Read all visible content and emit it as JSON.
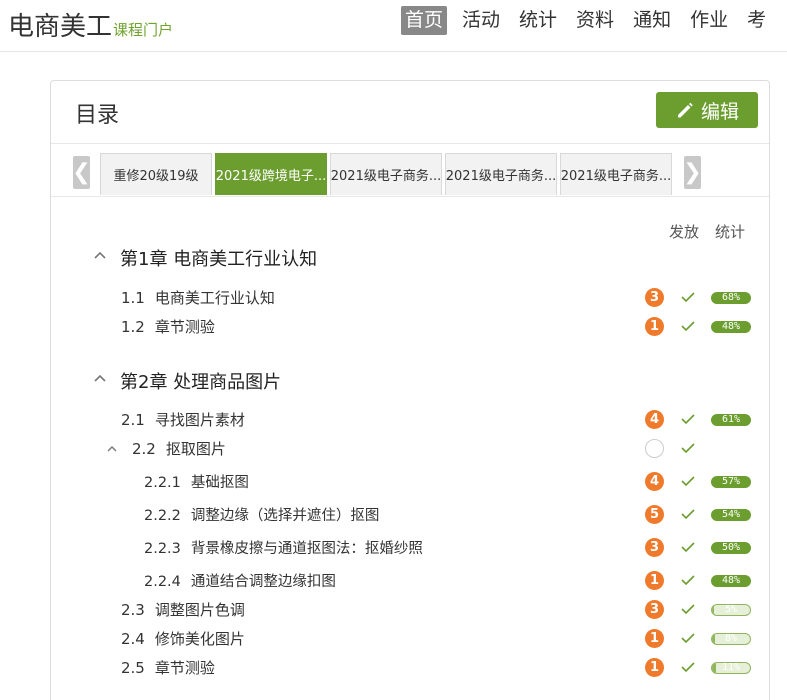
{
  "header": {
    "brand_title": "电商美工",
    "brand_sub": "课程门户",
    "nav": [
      "首页",
      "活动",
      "统计",
      "资料",
      "通知",
      "作业",
      "考"
    ]
  },
  "panel": {
    "title": "目录",
    "edit_label": "编辑",
    "prev_arrow": "❮",
    "next_arrow": "❯",
    "tabs": [
      "重修20级19级",
      "2021级跨境电子...",
      "2021级电子商务...",
      "2021级电子商务...",
      "2021级电子商务..."
    ],
    "col_publish": "发放",
    "col_stats": "统计"
  },
  "toc": {
    "ch1": {
      "num": "第1章",
      "title": "电商美工行业认知"
    },
    "ch1_items": [
      {
        "num": "1.1",
        "title": "电商美工行业认知",
        "badge": "3",
        "progress": "68%",
        "progress_value": 0.68
      },
      {
        "num": "1.2",
        "title": "章节测验",
        "badge": "1",
        "progress": "48%",
        "progress_value": 0.48
      }
    ],
    "ch2": {
      "num": "第2章",
      "title": "处理商品图片"
    },
    "ch2_items": [
      {
        "num": "2.1",
        "title": "寻找图片素材",
        "badge": "4",
        "progress": "61%",
        "progress_value": 0.61
      },
      {
        "num": "2.2",
        "title": "抠取图片",
        "badge": "",
        "progress": "",
        "progress_value": null
      },
      {
        "num": "2.2.1",
        "title": "基础抠图",
        "badge": "4",
        "progress": "57%",
        "progress_value": 0.57
      },
      {
        "num": "2.2.2",
        "title": "调整边缘（选择并遮住）抠图",
        "badge": "5",
        "progress": "54%",
        "progress_value": 0.54
      },
      {
        "num": "2.2.3",
        "title": "背景橡皮擦与通道抠图法：抠婚纱照",
        "badge": "3",
        "progress": "50%",
        "progress_value": 0.5
      },
      {
        "num": "2.2.4",
        "title": "通道结合调整边缘扣图",
        "badge": "1",
        "progress": "48%",
        "progress_value": 0.48
      },
      {
        "num": "2.3",
        "title": "调整图片色调",
        "badge": "3",
        "progress": "5%",
        "progress_value": 0.05
      },
      {
        "num": "2.4",
        "title": "修饰美化图片",
        "badge": "1",
        "progress": "8%",
        "progress_value": 0.08
      },
      {
        "num": "2.5",
        "title": "章节测验",
        "badge": "1",
        "progress": "11%",
        "progress_value": 0.11
      }
    ]
  },
  "colors": {
    "accent": "#6b9e2f",
    "badge": "#f07a2c"
  }
}
